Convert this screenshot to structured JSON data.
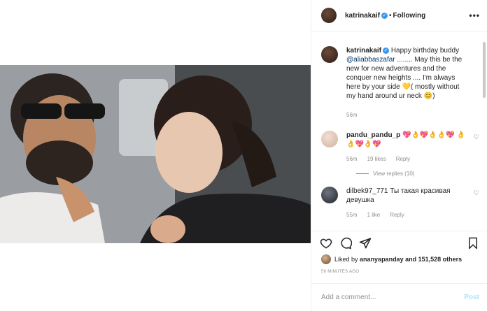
{
  "header": {
    "username": "katrinakaif",
    "separator": "•",
    "follow_status": "Following",
    "more": "•••"
  },
  "caption": {
    "username": "katrinakaif",
    "text_1": "Happy birthday buddy",
    "mention": "@aliabbaszafar",
    "text_2": "........ May this be the new for new adventures and the conquer new heights .... I'm always here by your side",
    "emoji_heart": "💛",
    "text_3": "( mostly without my hand around ur neck",
    "emoji_face": "😊",
    "text_4": ")",
    "time": "56m"
  },
  "comments": [
    {
      "username": "pandu_pandu_p",
      "text": "💖👌💖👌👌💖 👌👌💖👌💖",
      "time": "56m",
      "likes": "19 likes",
      "reply": "Reply",
      "view_replies": "View replies (10)"
    },
    {
      "username": "dilbek97_771",
      "text": "Ты такая красивая девушка",
      "time": "55m",
      "likes": "1 like",
      "reply": "Reply"
    }
  ],
  "liked_by": {
    "prefix": "Liked by",
    "user": "ananyapanday",
    "suffix": "and 151,528 others"
  },
  "timestamp": "56 MINUTES AGO",
  "add_comment": {
    "placeholder": "Add a comment...",
    "post_label": "Post"
  },
  "colors": {
    "link": "#00376b",
    "verified": "#3897f0",
    "muted": "#8e8e8e",
    "post_disabled": "#b2dffc"
  },
  "icons": [
    "heart-icon",
    "comment-icon",
    "share-icon",
    "bookmark-icon",
    "more-icon",
    "verified-icon"
  ]
}
